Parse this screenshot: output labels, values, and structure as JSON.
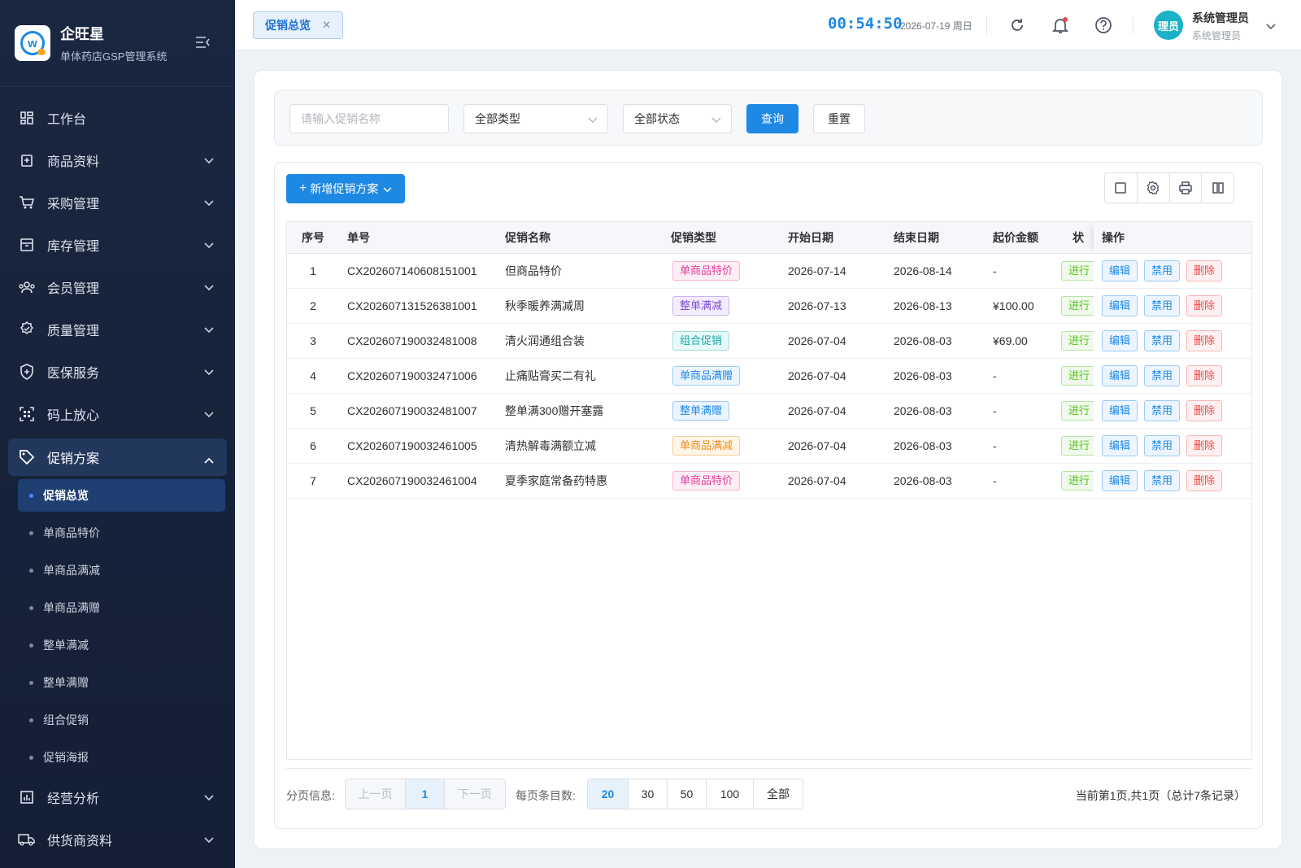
{
  "brand": {
    "title": "企旺星",
    "subtitle": "单体药店GSP管理系统"
  },
  "sidebar": {
    "items": [
      {
        "label": "工作台",
        "icon": "dashboard-icon",
        "expandable": false
      },
      {
        "label": "商品资料",
        "icon": "product-icon",
        "expandable": true
      },
      {
        "label": "采购管理",
        "icon": "cart-icon",
        "expandable": true
      },
      {
        "label": "库存管理",
        "icon": "inventory-icon",
        "expandable": true
      },
      {
        "label": "会员管理",
        "icon": "members-icon",
        "expandable": true
      },
      {
        "label": "质量管理",
        "icon": "quality-icon",
        "expandable": true
      },
      {
        "label": "医保服务",
        "icon": "shield-icon",
        "expandable": true
      },
      {
        "label": "码上放心",
        "icon": "qrcode-icon",
        "expandable": true
      }
    ],
    "open_item": {
      "label": "促销方案",
      "icon": "tag-icon"
    },
    "sub_items": [
      "促销总览",
      "单商品特价",
      "单商品满减",
      "单商品满赠",
      "整单满减",
      "整单满赠",
      "组合促销",
      "促销海报"
    ],
    "active_sub": "促销总览",
    "after_items": [
      {
        "label": "经营分析",
        "icon": "chart-icon"
      },
      {
        "label": "供货商资料",
        "icon": "truck-icon"
      }
    ]
  },
  "header": {
    "tab_label": "促销总览",
    "clock": "00:54:50",
    "date": "2026-07-19 周日",
    "avatar_text": "理员",
    "user_name": "系统管理员",
    "user_role": "系统管理员"
  },
  "filter": {
    "name_placeholder": "请输入促销名称",
    "type_value": "全部类型",
    "status_value": "全部状态",
    "query_label": "查询",
    "reset_label": "重置"
  },
  "panel": {
    "add_label": "新增促销方案"
  },
  "table": {
    "columns": [
      "序号",
      "单号",
      "促销名称",
      "促销类型",
      "开始日期",
      "结束日期",
      "起价金额",
      "状",
      "操作"
    ],
    "rows": [
      {
        "idx": "1",
        "no": "CX202607140608151001",
        "name": "但商品特价",
        "type": "单商品特价",
        "tagcolor": "pink",
        "start": "2026-07-14",
        "end": "2026-08-14",
        "amount": "-",
        "status": "进行"
      },
      {
        "idx": "2",
        "no": "CX202607131526381001",
        "name": "秋季暖养满减周",
        "type": "整单满减",
        "tagcolor": "purple",
        "start": "2026-07-13",
        "end": "2026-08-13",
        "amount": "¥100.00",
        "status": "进行"
      },
      {
        "idx": "3",
        "no": "CX202607190032481008",
        "name": "清火润通组合装",
        "type": "组合促销",
        "tagcolor": "teal",
        "start": "2026-07-04",
        "end": "2026-08-03",
        "amount": "¥69.00",
        "status": "进行"
      },
      {
        "idx": "4",
        "no": "CX202607190032471006",
        "name": "止痛贴膏买二有礼",
        "type": "单商品满赠",
        "tagcolor": "blue",
        "start": "2026-07-04",
        "end": "2026-08-03",
        "amount": "-",
        "status": "进行"
      },
      {
        "idx": "5",
        "no": "CX202607190032481007",
        "name": "整单满300赠开塞露",
        "type": "整单满赠",
        "tagcolor": "blue",
        "start": "2026-07-04",
        "end": "2026-08-03",
        "amount": "-",
        "status": "进行"
      },
      {
        "idx": "6",
        "no": "CX202607190032461005",
        "name": "清热解毒满额立减",
        "type": "单商品满减",
        "tagcolor": "orange",
        "start": "2026-07-04",
        "end": "2026-08-03",
        "amount": "-",
        "status": "进行"
      },
      {
        "idx": "7",
        "no": "CX202607190032461004",
        "name": "夏季家庭常备药特惠",
        "type": "单商品特价",
        "tagcolor": "pink",
        "start": "2026-07-04",
        "end": "2026-08-03",
        "amount": "-",
        "status": "进行"
      }
    ],
    "ops": {
      "edit": "编辑",
      "disable": "禁用",
      "delete": "删除"
    }
  },
  "pager": {
    "label": "分页信息:",
    "prev": "上一页",
    "page": "1",
    "next": "下一页",
    "size_label": "每页条目数:",
    "sizes": [
      "20",
      "30",
      "50",
      "100",
      "全部"
    ],
    "active_size": "20",
    "info": "当前第1页,共1页（总计7条记录）"
  },
  "colors": {
    "primary": "#1e88e5",
    "sidebar_bg": "#1a2740",
    "tag_pink": "#e6399b",
    "tag_purple": "#7b4bd6",
    "tag_teal": "#13a8a8",
    "tag_blue": "#1e88e5",
    "tag_orange": "#f08c1c",
    "status_green": "#52c41a",
    "danger": "#f04747"
  }
}
